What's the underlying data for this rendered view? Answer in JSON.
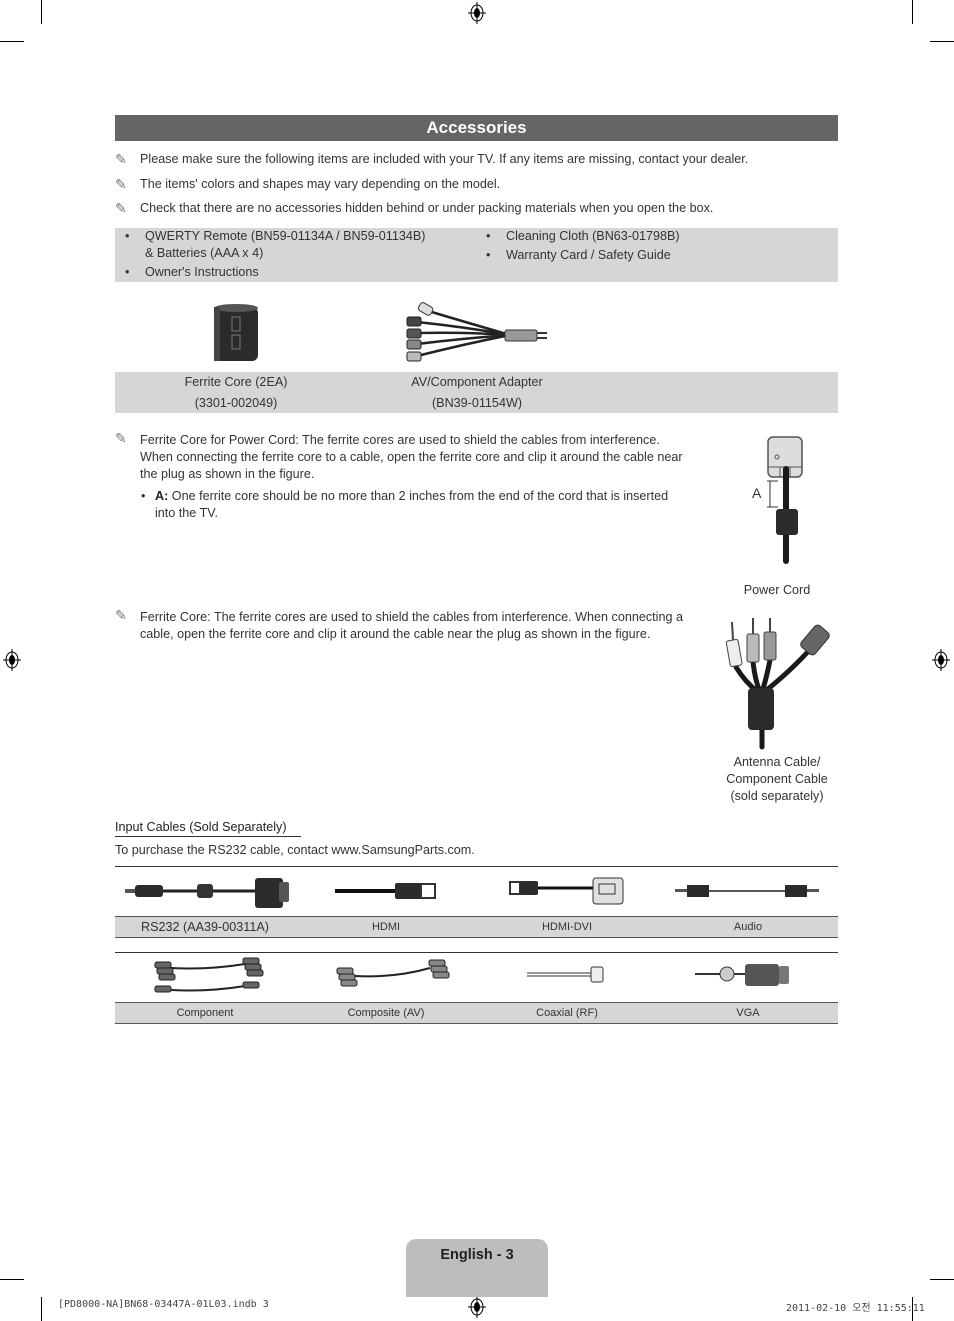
{
  "section_title": "Accessories",
  "notes": [
    "Please make sure the following items are included with your TV. If any items are missing, contact your dealer.",
    "The items' colors and shapes may vary depending on the model.",
    "Check that there are no accessories hidden behind or under packing materials when you open the box."
  ],
  "included_items": {
    "left": [
      {
        "line1": "QWERTY Remote (BN59-01134A / BN59-01134B)",
        "line2": "& Batteries (AAA x 4)"
      },
      {
        "line1": "Owner's Instructions"
      }
    ],
    "right": [
      {
        "line1": "Cleaning Cloth (BN63-01798B)"
      },
      {
        "line1": "Warranty Card / Safety Guide"
      }
    ]
  },
  "pictured_items": [
    {
      "name": "Ferrite Core (2EA)",
      "part": "(3301-002049)",
      "icon": "ferrite-core-icon"
    },
    {
      "name": "AV/Component Adapter",
      "part": "(BN39-01154W)",
      "icon": "av-component-adapter-icon"
    }
  ],
  "ferrite_power": {
    "lines": [
      "Ferrite Core for Power Cord: The ferrite cores are used to shield the cables from interference.",
      "When connecting the ferrite core to a cable, open the ferrite core and clip it around the cable near",
      "the plug as shown in the figure."
    ],
    "sub_label": "A:",
    "sub_lines": [
      "One ferrite core should be no more than 2 inches from the end of the cord that is inserted",
      "into the TV."
    ],
    "figure_marker": "A",
    "figure_caption": "Power Cord"
  },
  "ferrite_cable": {
    "lines": [
      "Ferrite Core: The ferrite cores are used to shield the cables from interference. When connecting a",
      "cable, open the ferrite core and clip it around the cable near the plug as shown in the figure."
    ],
    "figure_caption": [
      "Antenna Cable/",
      "Component Cable",
      "(sold separately)"
    ]
  },
  "input_cables": {
    "title": "Input Cables (Sold Separately)",
    "note": "To purchase the RS232 cable, contact www.SamsungParts.com.",
    "row1": [
      {
        "label": "RS232 (AA39-00311A)",
        "icon": "rs232-cable-icon"
      },
      {
        "label": "HDMI",
        "icon": "hdmi-cable-icon"
      },
      {
        "label": "HDMI-DVI",
        "icon": "hdmi-dvi-cable-icon"
      },
      {
        "label": "Audio",
        "icon": "audio-cable-icon"
      }
    ],
    "row2": [
      {
        "label": "Component",
        "icon": "component-cable-icon"
      },
      {
        "label": "Composite (AV)",
        "icon": "composite-cable-icon"
      },
      {
        "label": "Coaxial (RF)",
        "icon": "coaxial-cable-icon"
      },
      {
        "label": "VGA",
        "icon": "vga-cable-icon"
      }
    ]
  },
  "footer": {
    "page_label": "English - 3",
    "slug_left": "[PD8000-NA]BN68-03447A-01L03.indb   3",
    "slug_right": "2011-02-10   오전 11:55:11"
  },
  "colors": {
    "header_bg": "#656565",
    "box_bg": "#d6d6d6",
    "tab_bg": "#bdbdbd"
  }
}
